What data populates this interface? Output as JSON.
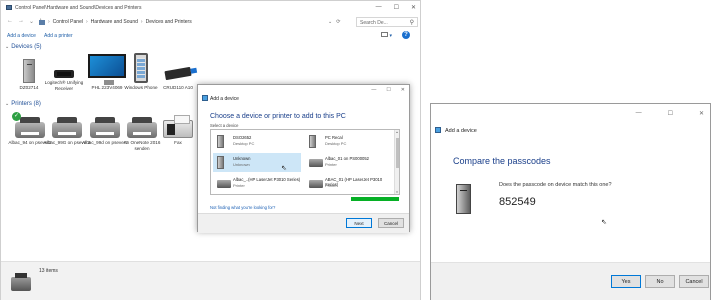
{
  "control_panel": {
    "title": "Control Panel\\Hardware and Sound\\Devices and Printers",
    "window_controls": [
      "—",
      "☐",
      "✕"
    ],
    "nav": {
      "back": "←",
      "forward": "→",
      "recent": "⌄",
      "up": "↑"
    },
    "breadcrumb": [
      "Control Panel",
      "Hardware and Sound",
      "Devices and Printers"
    ],
    "breadcrumb_sep": "›",
    "addr_dropdown": "⌄",
    "refresh": "⟳",
    "search_placeholder": "Search De...",
    "search_icon": "⚲",
    "commands": {
      "add_device": "Add a device",
      "add_printer": "Add a printer"
    },
    "view_dropdown": "▾",
    "help": "?",
    "devices_group": {
      "label": "Devices (5)",
      "chevron": "⌄"
    },
    "devices": [
      {
        "label": "DZ02714",
        "icon": "desktop-pc-icon"
      },
      {
        "label": "Logitech® Unifying Receiver",
        "icon": "usb-receiver-icon"
      },
      {
        "label": "PHL 223V4069",
        "icon": "monitor-icon"
      },
      {
        "label": "Windows Phone",
        "icon": "phone-icon"
      },
      {
        "label": "CRUD110 A10",
        "icon": "usb-drive-icon"
      }
    ],
    "printers_group": {
      "label": "Printers (8)",
      "chevron": "⌄"
    },
    "printers": [
      {
        "label": "Albac_94 on psever2",
        "icon": "printer-icon",
        "default": true
      },
      {
        "label": "Albac_99G on psever2",
        "icon": "printer-icon"
      },
      {
        "label": "Albac_99d on psever2",
        "icon": "printer-icon"
      },
      {
        "label": "An OneNote 2016 senden",
        "icon": "printer-icon"
      },
      {
        "label": "Fax",
        "icon": "fax-icon"
      }
    ],
    "default_mark": "✓",
    "status": "13 items"
  },
  "add_dialog": {
    "window_controls": [
      "—",
      "☐",
      "✕"
    ],
    "title": "Add a device",
    "heading": "Choose a device or printer to add to this PC",
    "subheading": "Select a device",
    "items": [
      {
        "name": "DSO2652",
        "type": "Desktop PC",
        "icon": "desktop-pc-icon"
      },
      {
        "name": "PC Recal",
        "type": "Desktop PC",
        "icon": "desktop-pc-icon"
      },
      {
        "name": "Unknown",
        "type": "Unknown",
        "icon": "desktop-pc-icon"
      },
      {
        "name": "Albac_01 on PS000052",
        "type": "Printer",
        "icon": "printer-icon"
      },
      {
        "name": "Albac_..(HP LaserJet P3010 Series)",
        "type": "Printer",
        "icon": "printer-icon"
      },
      {
        "name": "ABAC_01 (HP LaserJet P3010 Series)",
        "type": "Printer",
        "icon": "printer-icon"
      }
    ],
    "scroll_up": "▴",
    "scroll_down": "▾",
    "search_progress": 1.0,
    "not_found_link": "Not finding what you're looking for?",
    "buttons": {
      "next": "Next",
      "cancel": "Cancel"
    }
  },
  "compare_dialog": {
    "window_controls": [
      "—",
      "☐",
      "✕"
    ],
    "title": "Add a device",
    "heading": "Compare the passcodes",
    "question": "Does the passcode on device match this one?",
    "passcode": "852549",
    "buttons": {
      "yes": "Yes",
      "no": "No",
      "cancel": "Cancel"
    }
  },
  "cursor": "⇖",
  "colors": {
    "accent": "#1a3f8a",
    "link": "#1f5fa8",
    "selection": "#cde6f7",
    "progress": "#06b025",
    "default_badge": "#2ea043"
  }
}
